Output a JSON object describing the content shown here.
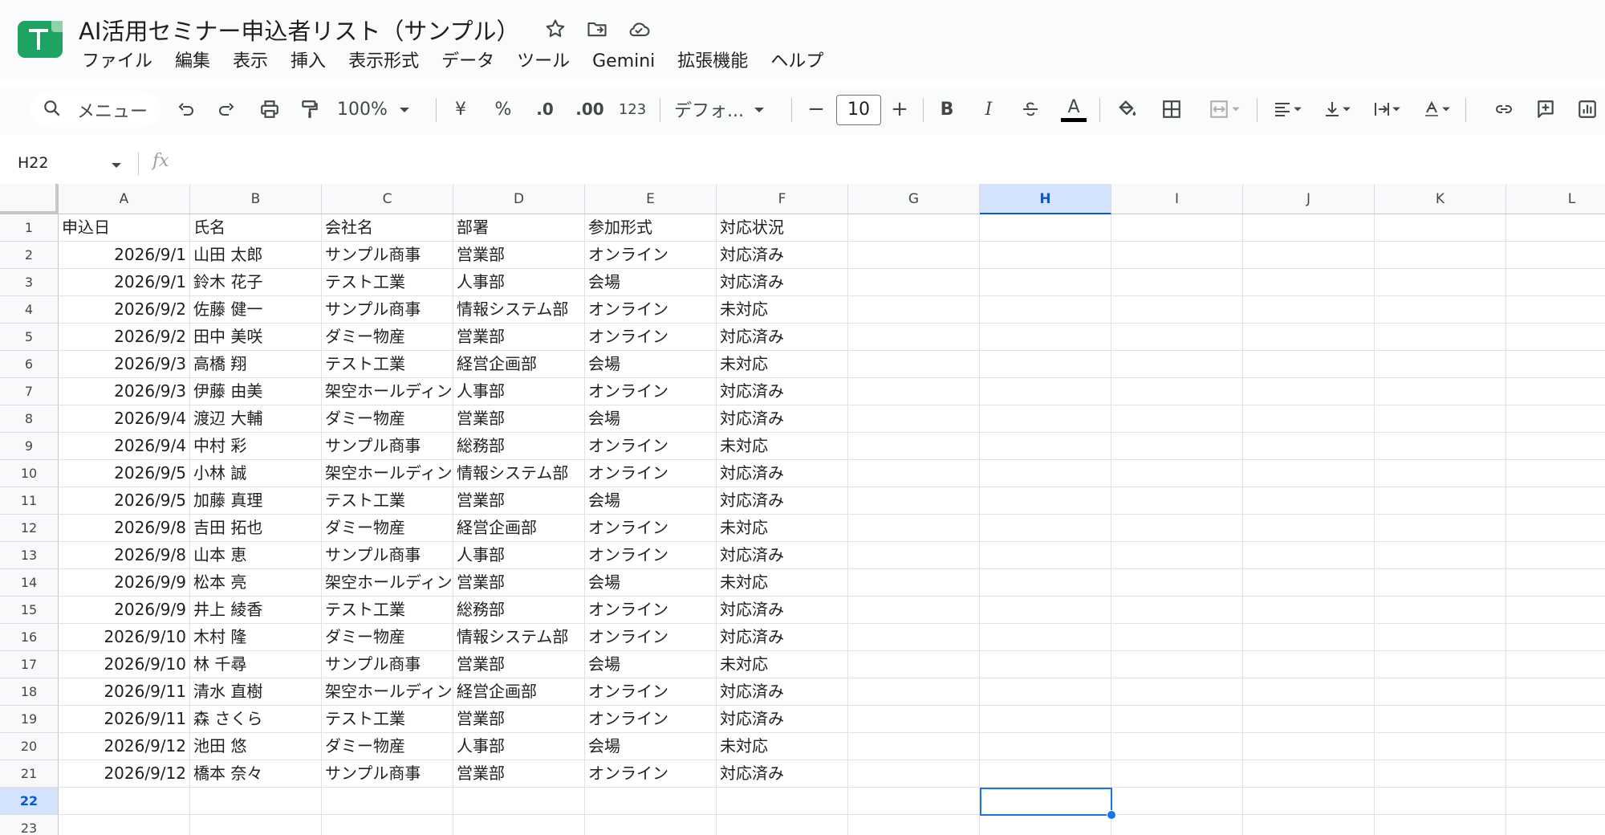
{
  "doc": {
    "title": "AI活用セミナー申込者リスト（サンプル）",
    "star_icon": "star-icon",
    "move_icon": "move-to-folder-icon",
    "cloud_icon": "cloud-saved-icon"
  },
  "menubar": [
    "ファイル",
    "編集",
    "表示",
    "挿入",
    "表示形式",
    "データ",
    "ツール",
    "Gemini",
    "拡張機能",
    "ヘルプ"
  ],
  "toolbar": {
    "menu_search": "メニュー",
    "zoom": "100%",
    "currency": "¥",
    "percent": "%",
    "dec_decrease": ".0",
    "dec_increase": ".00",
    "number_format": "123",
    "font": "デフォ...",
    "font_size": "10",
    "minus": "−",
    "plus": "+",
    "bold": "B",
    "italic": "I",
    "text_color": "A"
  },
  "formula_bar": {
    "name_box": "H22",
    "fx": "fx",
    "value": ""
  },
  "colors": {
    "accent": "#1a73e8",
    "selected_header": "#d3e3fd",
    "logo": "#1ea362"
  },
  "grid": {
    "columns": [
      "A",
      "B",
      "C",
      "D",
      "E",
      "F",
      "G",
      "H",
      "I",
      "J",
      "K",
      "L"
    ],
    "selected_column": "H",
    "selected_row": "22",
    "row_numbers": [
      "1",
      "2",
      "3",
      "4",
      "5",
      "6",
      "7",
      "8",
      "9",
      "10",
      "11",
      "12",
      "13",
      "14",
      "15",
      "16",
      "17",
      "18",
      "19",
      "20",
      "21",
      "22",
      "23"
    ],
    "rows": [
      [
        "申込日",
        "氏名",
        "会社名",
        "部署",
        "参加形式",
        "対応状況"
      ],
      [
        "2026/9/1",
        "山田 太郎",
        "サンプル商事",
        "営業部",
        "オンライン",
        "対応済み"
      ],
      [
        "2026/9/1",
        "鈴木 花子",
        "テスト工業",
        "人事部",
        "会場",
        "対応済み"
      ],
      [
        "2026/9/2",
        "佐藤 健一",
        "サンプル商事",
        "情報システム部",
        "オンライン",
        "未対応"
      ],
      [
        "2026/9/2",
        "田中 美咲",
        "ダミー物産",
        "営業部",
        "オンライン",
        "対応済み"
      ],
      [
        "2026/9/3",
        "高橋 翔",
        "テスト工業",
        "経営企画部",
        "会場",
        "未対応"
      ],
      [
        "2026/9/3",
        "伊藤 由美",
        "架空ホールディン",
        "人事部",
        "オンライン",
        "対応済み"
      ],
      [
        "2026/9/4",
        "渡辺 大輔",
        "ダミー物産",
        "営業部",
        "会場",
        "対応済み"
      ],
      [
        "2026/9/4",
        "中村 彩",
        "サンプル商事",
        "総務部",
        "オンライン",
        "未対応"
      ],
      [
        "2026/9/5",
        "小林 誠",
        "架空ホールディン",
        "情報システム部",
        "オンライン",
        "対応済み"
      ],
      [
        "2026/9/5",
        "加藤 真理",
        "テスト工業",
        "営業部",
        "会場",
        "対応済み"
      ],
      [
        "2026/9/8",
        "吉田 拓也",
        "ダミー物産",
        "経営企画部",
        "オンライン",
        "未対応"
      ],
      [
        "2026/9/8",
        "山本 恵",
        "サンプル商事",
        "人事部",
        "オンライン",
        "対応済み"
      ],
      [
        "2026/9/9",
        "松本 亮",
        "架空ホールディン",
        "営業部",
        "会場",
        "未対応"
      ],
      [
        "2026/9/9",
        "井上 綾香",
        "テスト工業",
        "総務部",
        "オンライン",
        "対応済み"
      ],
      [
        "2026/9/10",
        "木村 隆",
        "ダミー物産",
        "情報システム部",
        "オンライン",
        "対応済み"
      ],
      [
        "2026/9/10",
        "林 千尋",
        "サンプル商事",
        "営業部",
        "会場",
        "未対応"
      ],
      [
        "2026/9/11",
        "清水 直樹",
        "架空ホールディン",
        "経営企画部",
        "オンライン",
        "対応済み"
      ],
      [
        "2026/9/11",
        "森 さくら",
        "テスト工業",
        "営業部",
        "オンライン",
        "対応済み"
      ],
      [
        "2026/9/12",
        "池田 悠",
        "ダミー物産",
        "人事部",
        "会場",
        "未対応"
      ],
      [
        "2026/9/12",
        "橋本 奈々",
        "サンプル商事",
        "営業部",
        "オンライン",
        "対応済み"
      ]
    ]
  }
}
